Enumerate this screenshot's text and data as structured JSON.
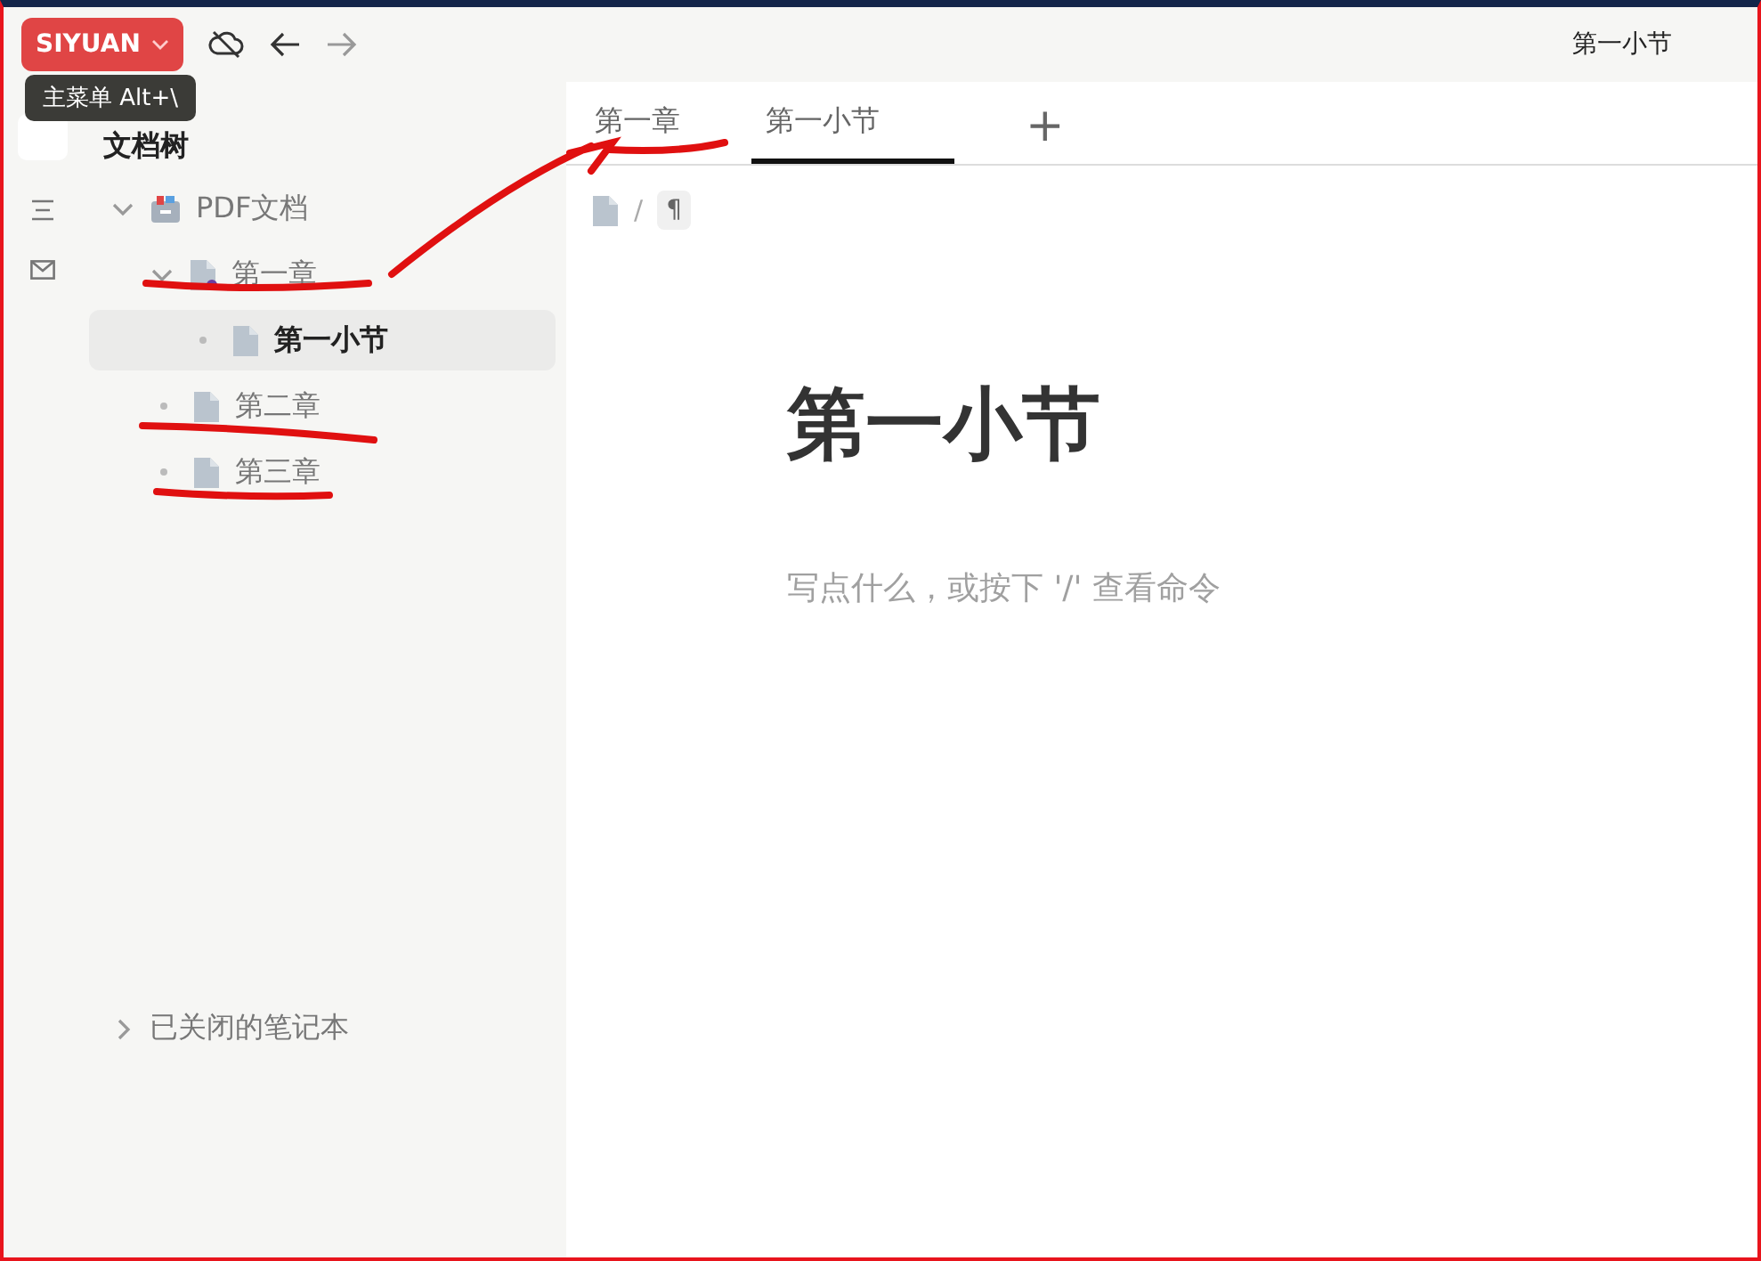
{
  "topbar": {
    "brand": "SIYUAN",
    "window_title": "第一小节",
    "tooltip": "主菜单 Alt+\\"
  },
  "sidebar": {
    "title": "文档树",
    "tree": [
      {
        "label": "PDF文档",
        "kind": "notebook",
        "expanded": true,
        "selected": false,
        "children": [
          {
            "label": "第一章",
            "kind": "doc",
            "expanded": true,
            "selected": false,
            "children": [
              {
                "label": "第一小节",
                "kind": "doc",
                "selected": true
              }
            ]
          },
          {
            "label": "第二章",
            "kind": "doc",
            "selected": false
          },
          {
            "label": "第三章",
            "kind": "doc",
            "selected": false
          }
        ]
      }
    ],
    "closed_notebooks": {
      "label": "已关闭的笔记本",
      "expanded": false
    }
  },
  "tabs": [
    {
      "label": "第一章",
      "selected": false
    },
    {
      "label": "第一小节",
      "selected": true
    }
  ],
  "tab_add": "+",
  "breadcrumb": {
    "separator": "/",
    "block": "¶"
  },
  "editor": {
    "title": "第一小节",
    "placeholder": "写点什么，或按下 '/' 查看命令"
  }
}
